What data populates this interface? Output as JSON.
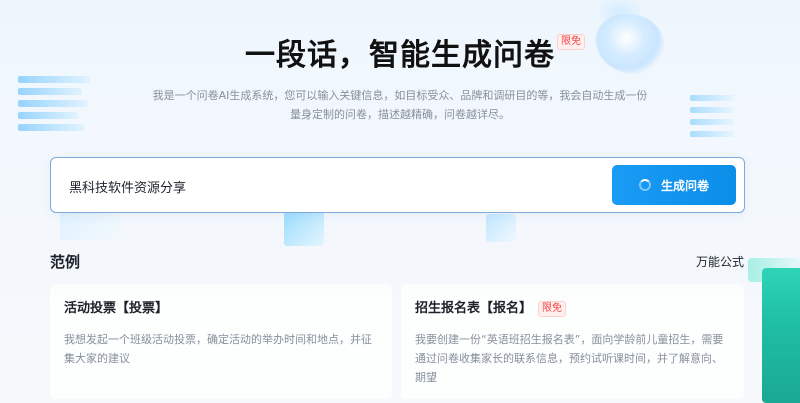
{
  "hero": {
    "title": "一段话，智能生成问卷",
    "title_badge": "限免",
    "description_line1": "我是一个问卷AI生成系统，您可以输入关键信息，如目标受众、品牌和调研目的等，我会自动生成一份",
    "description_line2": "量身定制的问卷，描述越精确，问卷越详尽。"
  },
  "search": {
    "value": "黑科技软件资源分享",
    "button_label": "生成问卷"
  },
  "examples": {
    "section_title": "范例",
    "formula_link": "万能公式",
    "cards": [
      {
        "title": "活动投票【投票】",
        "badge": "",
        "text": "我想发起一个班级活动投票，确定活动的举办时间和地点，并征集大家的建议"
      },
      {
        "title": "招生报名表【报名】",
        "badge": "限免",
        "text": "我要创建一份“英语班招生报名表”，面向学龄前儿童招生，需要通过问卷收集家长的联系信息，预约试听课时间，并了解意向、期望"
      }
    ]
  },
  "colors": {
    "accent": "#1a9bf5",
    "badge_red": "#f53f3f",
    "muted_text": "#86909c"
  }
}
